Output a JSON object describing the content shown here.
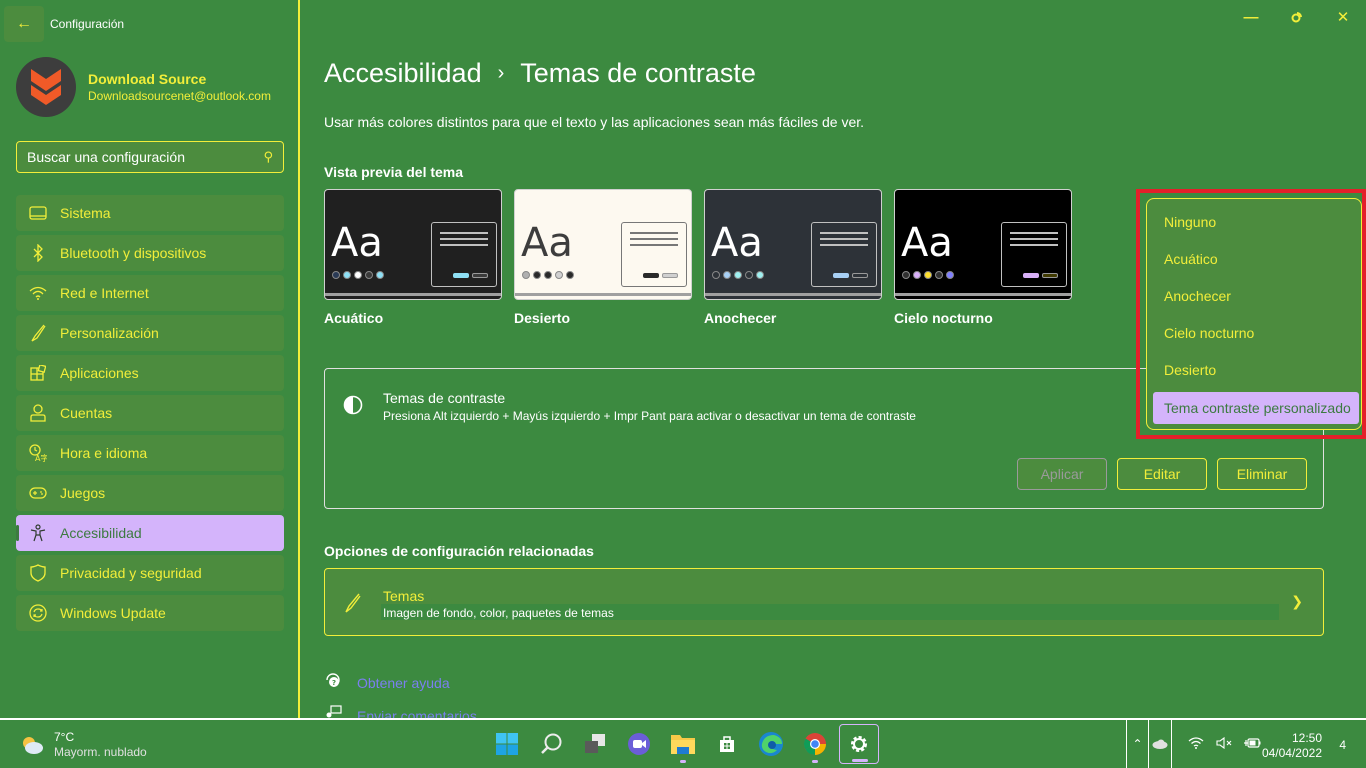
{
  "window": {
    "title": "Configuración",
    "controls": {
      "minimize": "minimize-icon",
      "restore": "restore-icon",
      "close": "close-icon"
    }
  },
  "profile": {
    "name": "Download Source",
    "email": "Downloadsourcenet@outlook.com"
  },
  "search": {
    "placeholder": "Buscar una configuración",
    "value": ""
  },
  "sidebar": {
    "items": [
      {
        "label": "Sistema",
        "icon": "monitor-icon",
        "active": false
      },
      {
        "label": "Bluetooth y dispositivos",
        "icon": "bluetooth-icon",
        "active": false
      },
      {
        "label": "Red e Internet",
        "icon": "wifi-icon",
        "active": false
      },
      {
        "label": "Personalización",
        "icon": "brush-icon",
        "active": false
      },
      {
        "label": "Aplicaciones",
        "icon": "apps-icon",
        "active": false
      },
      {
        "label": "Cuentas",
        "icon": "person-icon",
        "active": false
      },
      {
        "label": "Hora e idioma",
        "icon": "time-language-icon",
        "active": false
      },
      {
        "label": "Juegos",
        "icon": "gamepad-icon",
        "active": false
      },
      {
        "label": "Accesibilidad",
        "icon": "accessibility-icon",
        "active": true
      },
      {
        "label": "Privacidad y seguridad",
        "icon": "shield-icon",
        "active": false
      },
      {
        "label": "Windows Update",
        "icon": "update-icon",
        "active": false
      }
    ]
  },
  "main": {
    "breadcrumb": {
      "parent": "Accesibilidad",
      "separator": "›",
      "current": "Temas de contraste"
    },
    "description": "Usar más colores distintos para que el texto y las aplicaciones sean más fáciles de ver.",
    "preview_title": "Vista previa del tema",
    "previews": [
      {
        "label": "Acuático",
        "bg": "#202020",
        "fg": "#ffffff",
        "dots": [
          "#2a3a55",
          "#8fe0f5",
          "#ffffff",
          "#3a3a3a",
          "#8fe0f5"
        ],
        "btn1": "#8fe0f5",
        "btn2": "#3a3a3a"
      },
      {
        "label": "Desierto",
        "bg": "#fdf9f0",
        "fg": "#3d3d3d",
        "dots": [
          "#b0b0b0",
          "#2a2a2a",
          "#2a2a2a",
          "#d0d0d0",
          "#2a2a2a"
        ],
        "btn1": "#2a2a2a",
        "btn2": "#d0d0d0"
      },
      {
        "label": "Anochecer",
        "bg": "#2d3238",
        "fg": "#ffffff",
        "dots": [
          "#2d3238",
          "#a8d0f5",
          "#a0f0f0",
          "#2d3238",
          "#a0f0f0"
        ],
        "btn1": "#a8d0f5",
        "btn2": "#2d3238"
      },
      {
        "label": "Cielo nocturno",
        "bg": "#000000",
        "fg": "#ffffff",
        "dots": [
          "#303030",
          "#d8b0f8",
          "#ffe030",
          "#303030",
          "#8080ff"
        ],
        "btn1": "#d8b0f8",
        "btn2": "#403a00"
      }
    ],
    "contrast_panel": {
      "title": "Temas de contraste",
      "description": "Presiona Alt izquierdo + Mayús izquierdo + Impr Pant para activar o desactivar un tema de contraste",
      "buttons": {
        "apply": "Aplicar",
        "edit": "Editar",
        "delete": "Eliminar"
      }
    },
    "theme_dropdown": {
      "options": [
        "Ninguno",
        "Acuático",
        "Anochecer",
        "Cielo nocturno",
        "Desierto",
        "Tema contraste personalizado"
      ],
      "selected": "Tema contraste personalizado"
    },
    "related_title": "Opciones de configuración relacionadas",
    "related": {
      "title": "Temas",
      "description": "Imagen de fondo, color, paquetes de temas"
    },
    "help_links": {
      "help": "Obtener ayuda",
      "feedback": "Enviar comentarios"
    }
  },
  "taskbar": {
    "weather": {
      "temp": "7°C",
      "desc": "Mayorm. nublado"
    },
    "apps": [
      {
        "name": "start",
        "icon": "windows-start-icon",
        "running": false,
        "active": false
      },
      {
        "name": "search",
        "icon": "search-icon",
        "running": false,
        "active": false
      },
      {
        "name": "task-view",
        "icon": "task-view-icon",
        "running": false,
        "active": false
      },
      {
        "name": "chat",
        "icon": "teams-chat-icon",
        "running": false,
        "active": false
      },
      {
        "name": "file-explorer",
        "icon": "folder-icon",
        "running": true,
        "active": false
      },
      {
        "name": "store",
        "icon": "store-icon",
        "running": false,
        "active": false
      },
      {
        "name": "edge",
        "icon": "edge-icon",
        "running": false,
        "active": false
      },
      {
        "name": "chrome",
        "icon": "chrome-icon",
        "running": true,
        "active": false
      },
      {
        "name": "settings",
        "icon": "settings-gear-icon",
        "running": true,
        "active": true
      }
    ],
    "clock": {
      "time": "12:50",
      "date": "04/04/2022"
    },
    "notifications": "4"
  },
  "colors": {
    "background": "#3c8a40",
    "accent_text": "#f2ee3a",
    "selection": "#d4b4fb",
    "highlight_box": "#e3202a",
    "link": "#7b7ff0"
  }
}
